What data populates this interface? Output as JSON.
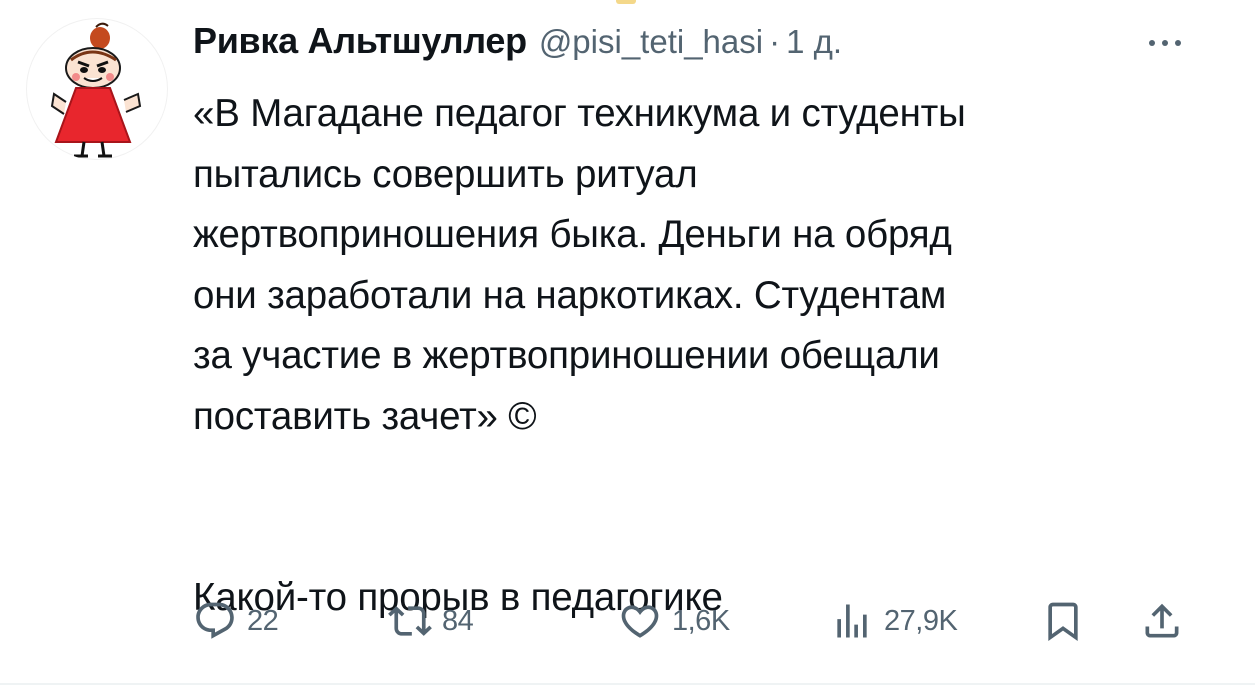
{
  "tweet": {
    "author": {
      "display_name": "Ривка Альтшуллер",
      "handle": "@pisi_teti_hasi",
      "avatar": "little-my-avatar"
    },
    "separator": "·",
    "time": "1 д.",
    "more_icon": "more-dots-icon",
    "text": "«В Магадане педагог техникума и студенты\nпытались совершить ритуал\nжертвоприношения быка. Деньги на обряд\nони заработали на наркотиках. Студентам\nза участие в жертвоприношении обещали\nпоставить зачет» ©\n\n\nКакой-то прорыв в педагогике",
    "actions": {
      "reply": {
        "icon": "reply-icon",
        "count": "22"
      },
      "retweet": {
        "icon": "retweet-icon",
        "count": "84"
      },
      "like": {
        "icon": "heart-icon",
        "count": "1,6K"
      },
      "views": {
        "icon": "views-chart-icon",
        "count": "27,9K"
      },
      "bookmark": {
        "icon": "bookmark-icon"
      },
      "share": {
        "icon": "share-icon"
      }
    }
  },
  "colors": {
    "text_primary": "#0f1419",
    "text_secondary": "#536471",
    "background": "#ffffff",
    "avatar_dress": "#e8262d",
    "divider": "#eff3f4"
  }
}
